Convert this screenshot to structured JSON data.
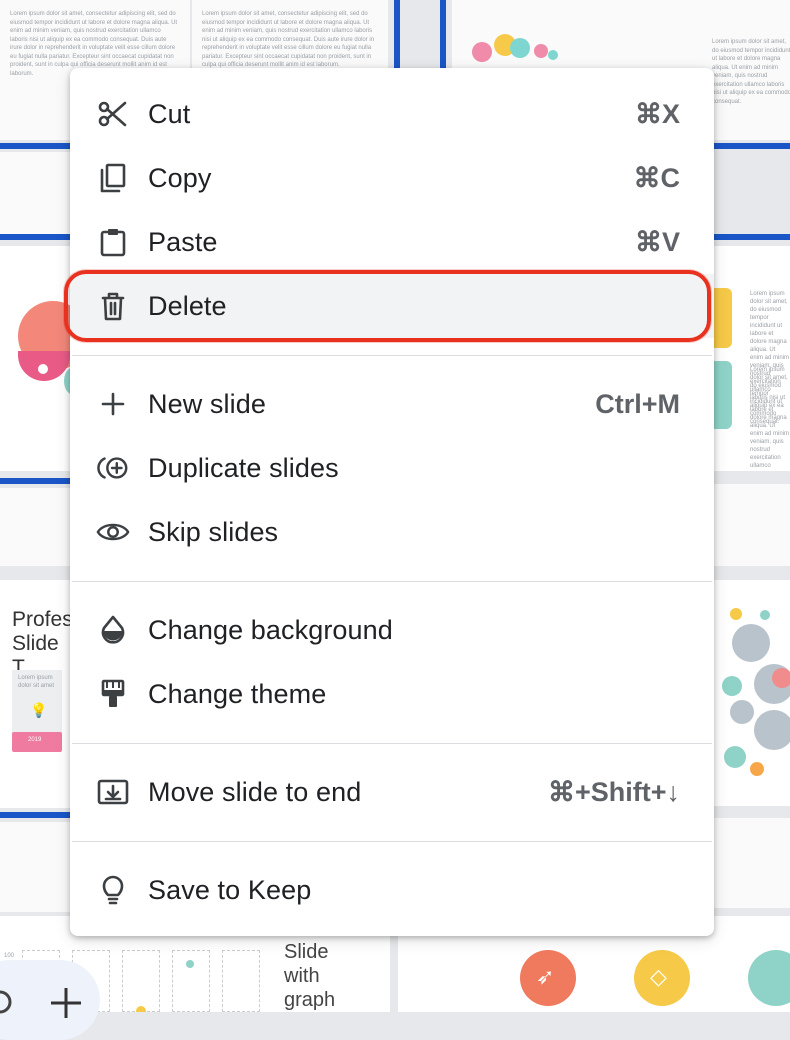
{
  "background": {
    "lorem_text": "Lorem ipsum dolor sit amet, consectetur adipiscing elit, sed do eiusmod tempor incididunt ut labore et dolore magna aliqua. Ut enim ad minim veniam, quis nostrud exercitation ullamco laboris nisi ut aliquip ex ea commodo consequat. Duis aute irure dolor in reprehenderit in voluptate velit esse cillum dolore eu fugiat nulla pariatur. Excepteur sint occaecat cupidatat non proident, sunt in culpa qui officia deserunt mollit anim id est laborum.",
    "lorem_short": "Lorem ipsum dolor sit amet, do eiusmod tempor incididunt ut labore et dolore magna aliqua. Ut enim ad minim veniam, quis nostrud exercitation ullamco laboris nisi ut aliquip ex ea commodo consequat.",
    "lorem_label": "Lorem ipsum dolor sit amet",
    "partial_title_1": "Profes",
    "partial_title_2": "Slide T",
    "year_badge": "2019",
    "slide_title": "Slide with graph",
    "grid_number": "100"
  },
  "menu": {
    "highlight_color": "#e8321f",
    "groups": [
      [
        {
          "icon": "scissors-icon",
          "label": "Cut",
          "shortcut": "⌘X"
        },
        {
          "icon": "copy-icon",
          "label": "Copy",
          "shortcut": "⌘C"
        },
        {
          "icon": "paste-icon",
          "label": "Paste",
          "shortcut": "⌘V"
        },
        {
          "icon": "trash-icon",
          "label": "Delete",
          "shortcut": "",
          "highlighted": true
        }
      ],
      [
        {
          "icon": "plus-icon",
          "label": "New slide",
          "shortcut": "Ctrl+M"
        },
        {
          "icon": "duplicate-icon",
          "label": "Duplicate slides",
          "shortcut": ""
        },
        {
          "icon": "eye-icon",
          "label": "Skip slides",
          "shortcut": ""
        }
      ],
      [
        {
          "icon": "droplet-icon",
          "label": "Change background",
          "shortcut": ""
        },
        {
          "icon": "paint-roller-icon",
          "label": "Change theme",
          "shortcut": ""
        }
      ],
      [
        {
          "icon": "move-to-end-icon",
          "label": "Move slide to end",
          "shortcut": "⌘+Shift+↓"
        }
      ],
      [
        {
          "icon": "lightbulb-icon",
          "label": "Save to Keep",
          "shortcut": ""
        }
      ]
    ]
  }
}
